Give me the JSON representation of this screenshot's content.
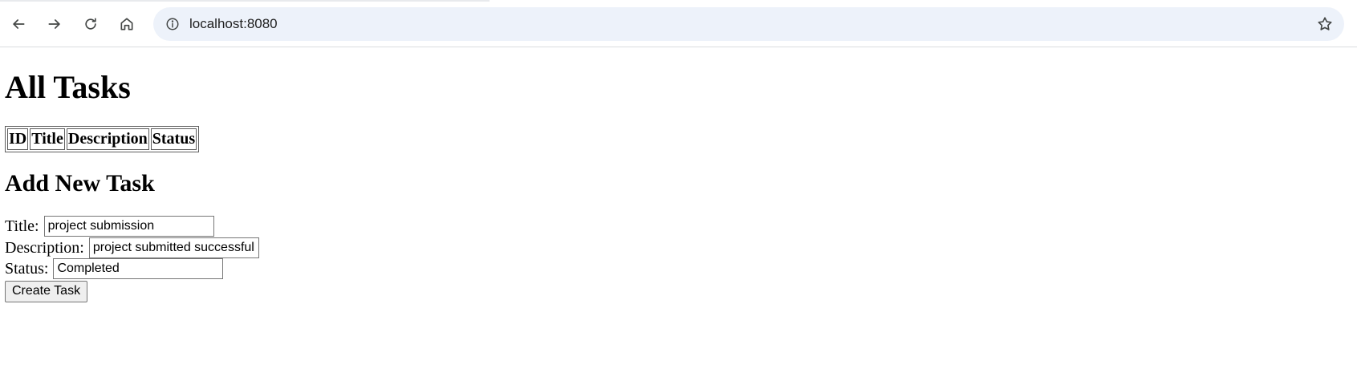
{
  "browser": {
    "url": "localhost:8080",
    "icons": {
      "back": "arrow-left",
      "forward": "arrow-right",
      "reload": "reload",
      "home": "home",
      "site_info": "info-circle",
      "bookmark": "star-outline"
    },
    "omnibox_color": "#edf2fa"
  },
  "page": {
    "title": "All Tasks",
    "table": {
      "headers": [
        "ID",
        "Title",
        "Description",
        "Status"
      ],
      "rows": []
    },
    "form": {
      "heading": "Add New Task",
      "title_label": "Title:",
      "title_value": "project submission",
      "description_label": "Description:",
      "description_value": "project submitted successfully",
      "status_label": "Status:",
      "status_value": "Completed",
      "submit_label": "Create Task"
    }
  }
}
